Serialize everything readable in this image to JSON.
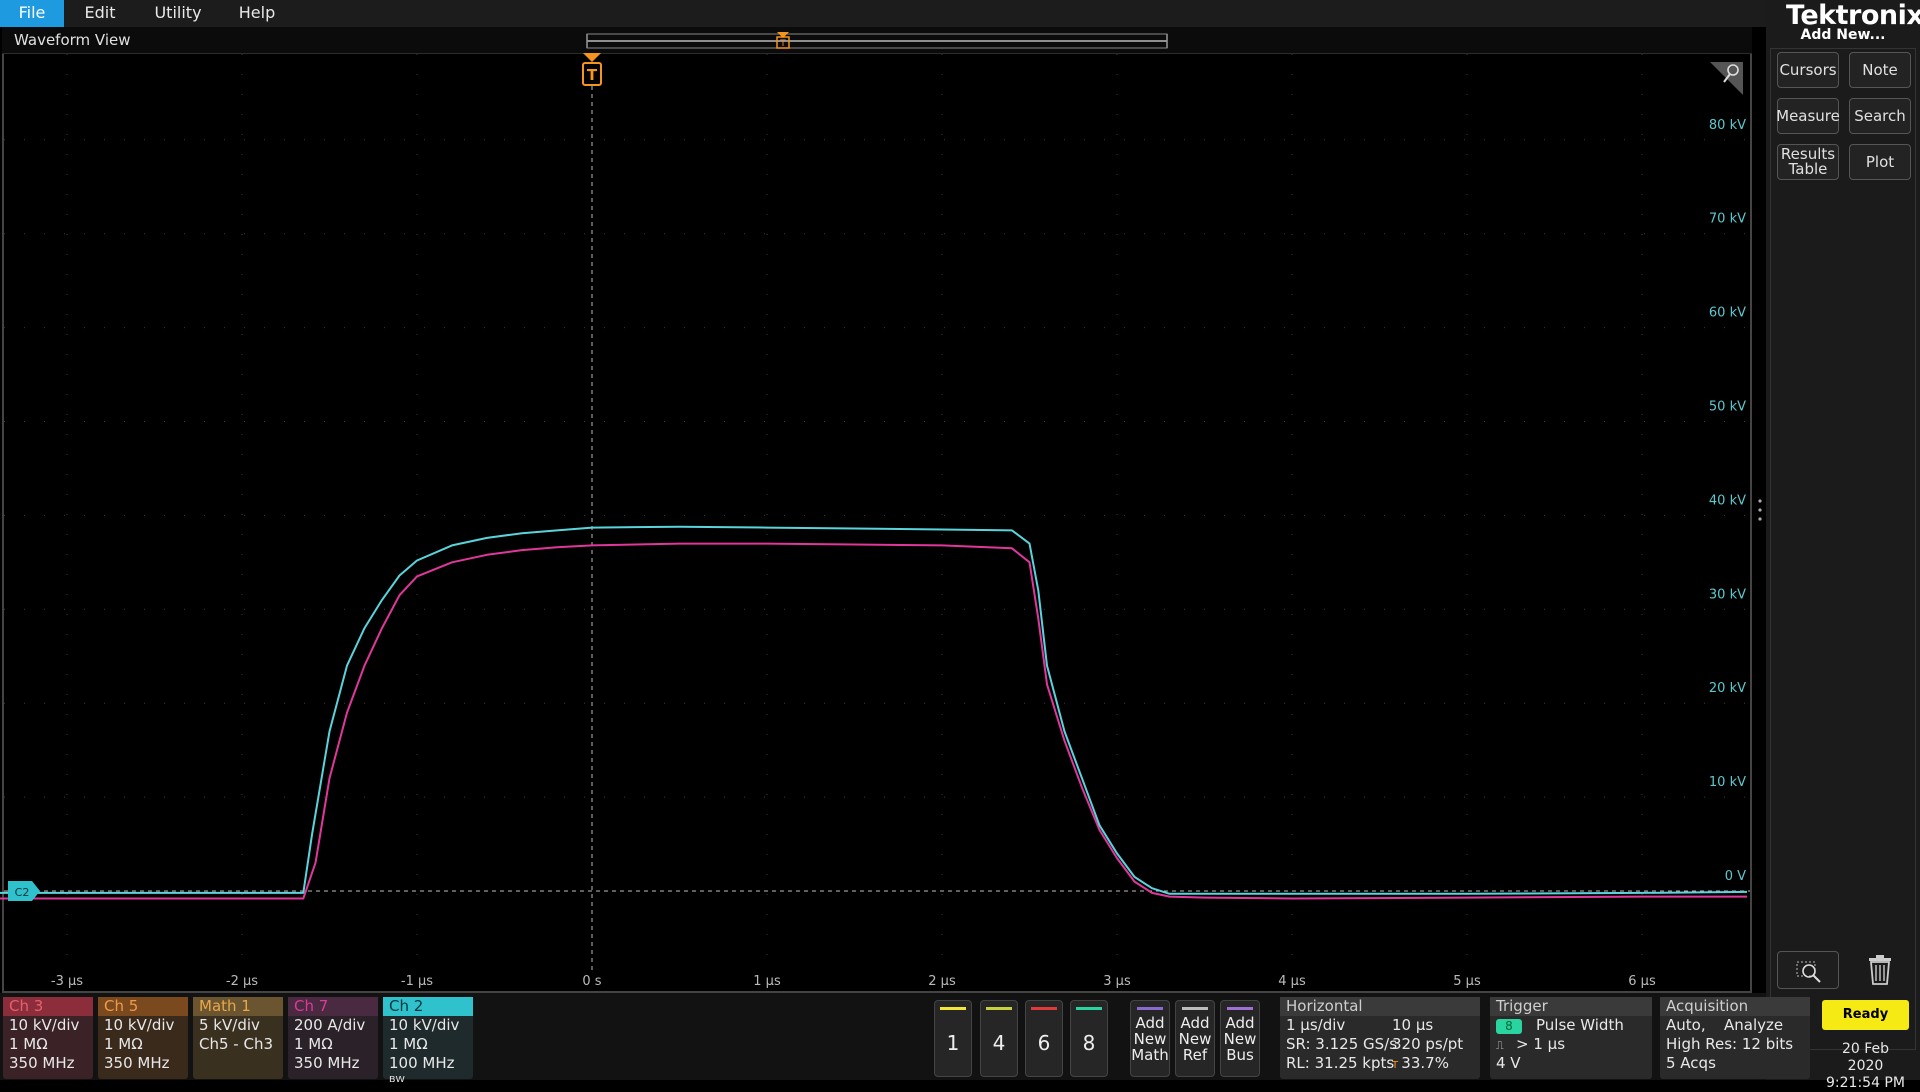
{
  "menu": [
    "File",
    "Edit",
    "Utility",
    "Help"
  ],
  "waveform_view": {
    "title": "Waveform View",
    "trigger_marker": "T",
    "ground_marker": "C2",
    "x_ticks": [
      "-3 µs",
      "-2 µs",
      "-1 µs",
      "0 s",
      "1 µs",
      "2 µs",
      "3 µs",
      "4 µs",
      "5 µs",
      "6 µs"
    ],
    "y_ticks": [
      "80 kV",
      "70 kV",
      "60 kV",
      "50 kV",
      "40 kV",
      "30 kV",
      "20 kV",
      "10 kV",
      "0 V"
    ]
  },
  "colors": {
    "ch2_cyan": "#5ad4dc",
    "ch7_magenta": "#e0379b",
    "trigger_orange": "#f5941e",
    "axis_label_teal": "#5cc9cf",
    "ready_yellow": "#f5ea14"
  },
  "chart_data": {
    "type": "line",
    "x_unit": "µs",
    "y_unit": "kV",
    "xlim": [
      -3.4,
      6.6
    ],
    "ylim": [
      -10,
      90
    ],
    "series": [
      {
        "name": "Ch 2",
        "color": "#5ad4dc",
        "points": [
          [
            -3.4,
            -0.2
          ],
          [
            -1.65,
            -0.2
          ],
          [
            -1.6,
            6
          ],
          [
            -1.5,
            17
          ],
          [
            -1.4,
            24
          ],
          [
            -1.3,
            28
          ],
          [
            -1.2,
            31
          ],
          [
            -1.1,
            33.6
          ],
          [
            -1.0,
            35.2
          ],
          [
            -0.8,
            36.8
          ],
          [
            -0.6,
            37.6
          ],
          [
            -0.4,
            38.1
          ],
          [
            -0.2,
            38.4
          ],
          [
            0,
            38.7
          ],
          [
            0.5,
            38.8
          ],
          [
            1.0,
            38.7
          ],
          [
            1.5,
            38.6
          ],
          [
            2.0,
            38.5
          ],
          [
            2.4,
            38.4
          ],
          [
            2.5,
            37
          ],
          [
            2.55,
            32
          ],
          [
            2.6,
            24
          ],
          [
            2.7,
            17
          ],
          [
            2.8,
            12
          ],
          [
            2.9,
            7
          ],
          [
            3.0,
            4
          ],
          [
            3.1,
            1.5
          ],
          [
            3.2,
            0.3
          ],
          [
            3.3,
            -0.3
          ],
          [
            3.5,
            -0.3
          ],
          [
            4.0,
            -0.3
          ],
          [
            5.0,
            -0.3
          ],
          [
            6.0,
            -0.2
          ],
          [
            6.6,
            -0.1
          ]
        ]
      },
      {
        "name": "Ch 7",
        "color": "#e0379b",
        "points": [
          [
            -3.4,
            -0.8
          ],
          [
            -1.65,
            -0.8
          ],
          [
            -1.58,
            3
          ],
          [
            -1.5,
            12
          ],
          [
            -1.4,
            19
          ],
          [
            -1.3,
            24
          ],
          [
            -1.2,
            28
          ],
          [
            -1.1,
            31.5
          ],
          [
            -1.0,
            33.5
          ],
          [
            -0.8,
            35
          ],
          [
            -0.6,
            35.8
          ],
          [
            -0.4,
            36.3
          ],
          [
            -0.2,
            36.6
          ],
          [
            0,
            36.8
          ],
          [
            0.5,
            37.0
          ],
          [
            1.0,
            37.0
          ],
          [
            1.5,
            36.9
          ],
          [
            2.0,
            36.8
          ],
          [
            2.4,
            36.5
          ],
          [
            2.5,
            35
          ],
          [
            2.55,
            29
          ],
          [
            2.6,
            22
          ],
          [
            2.7,
            16
          ],
          [
            2.8,
            11
          ],
          [
            2.9,
            6.5
          ],
          [
            3.0,
            3.5
          ],
          [
            3.1,
            1
          ],
          [
            3.2,
            -0.2
          ],
          [
            3.3,
            -0.6
          ],
          [
            3.5,
            -0.7
          ],
          [
            4.0,
            -0.8
          ],
          [
            5.0,
            -0.7
          ],
          [
            6.0,
            -0.6
          ],
          [
            6.6,
            -0.6
          ]
        ]
      }
    ]
  },
  "right_panel": {
    "brand": "Tektronix",
    "add_new_title": "Add New...",
    "buttons": [
      "Cursors",
      "Note",
      "Measure",
      "Search",
      "Results Table",
      "Plot"
    ]
  },
  "channels": [
    {
      "name": "Ch 3",
      "lines": [
        "10 kV/div",
        "1 MΩ",
        "350 MHz"
      ],
      "hdr_bg": "#8b2d3a",
      "hdr_fg": "#e86070",
      "body_bg": "#3a2226"
    },
    {
      "name": "Ch 5",
      "lines": [
        "10 kV/div",
        "1 MΩ",
        "350 MHz"
      ],
      "hdr_bg": "#7a4a1e",
      "hdr_fg": "#f09a4a",
      "body_bg": "#3a2a1c"
    },
    {
      "name": "Math 1",
      "lines": [
        "5 kV/div",
        "Ch5 - Ch3",
        ""
      ],
      "hdr_bg": "#6b5530",
      "hdr_fg": "#e8a848",
      "body_bg": "#3a3020"
    },
    {
      "name": "Ch 7",
      "lines": [
        "200 A/div",
        "1 MΩ",
        "350 MHz"
      ],
      "hdr_bg": "#4a2a40",
      "hdr_fg": "#e0379b",
      "body_bg": "#2a2228"
    },
    {
      "name": "Ch 2",
      "lines": [
        "10 kV/div",
        "1 MΩ",
        "100 MHz ᴮᵂ"
      ],
      "hdr_bg": "#2fc2cc",
      "hdr_fg": "#06363a",
      "body_bg": "#1f2a2c"
    }
  ],
  "channel_buttons": [
    {
      "label": "1",
      "color": "#f2e63a"
    },
    {
      "label": "4",
      "color": "#c8d040"
    },
    {
      "label": "6",
      "color": "#e23a3a"
    },
    {
      "label": "8",
      "color": "#2ad4a0"
    }
  ],
  "add_buttons": [
    {
      "label": "Add New Math",
      "color": "#8a6ad0"
    },
    {
      "label": "Add New Ref",
      "color": "#bbbbbb"
    },
    {
      "label": "Add New Bus",
      "color": "#a070d8"
    }
  ],
  "horizontal": {
    "title": "Horizontal",
    "l1a": "1 µs/div",
    "l1b": "10 µs",
    "l2a": "SR: 3.125 GS/s",
    "l2b": "320 ps/pt",
    "l3a": "RL: 31.25 kpts",
    "l3b": "33.7%"
  },
  "trigger": {
    "title": "Trigger",
    "source": "8",
    "type": "Pulse Width",
    "cond": "> 1 µs",
    "level": "4 V"
  },
  "acquisition": {
    "title": "Acquisition",
    "l1a": "Auto,",
    "l1b": "Analyze",
    "l2": "High Res: 12 bits",
    "l3": "5 Acqs"
  },
  "status": {
    "ready": "Ready",
    "date": "20 Feb 2020",
    "time": "9:21:54 PM"
  }
}
